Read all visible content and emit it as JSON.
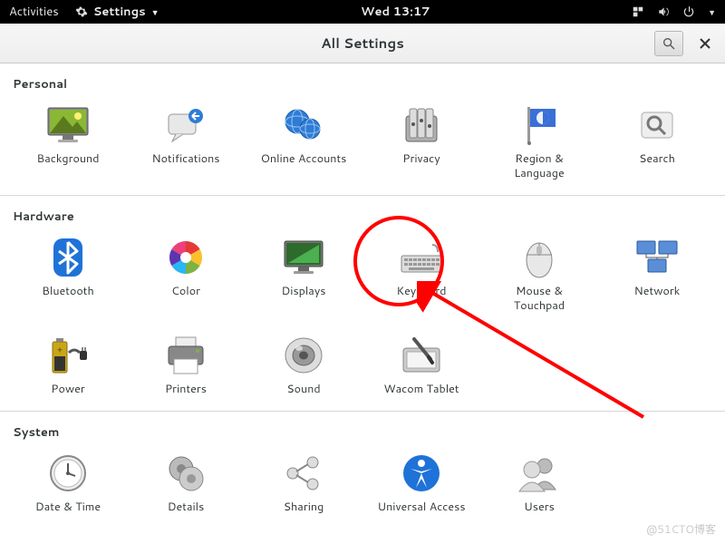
{
  "top_panel": {
    "activities": "Activities",
    "app_name": "Settings",
    "clock": "Wed 13:17"
  },
  "header": {
    "title": "All Settings"
  },
  "sections": {
    "personal": {
      "label": "Personal",
      "items": [
        {
          "name": "background",
          "label": "Background"
        },
        {
          "name": "notifications",
          "label": "Notifications"
        },
        {
          "name": "online-accounts",
          "label": "Online Accounts"
        },
        {
          "name": "privacy",
          "label": "Privacy"
        },
        {
          "name": "region-language",
          "label": "Region & Language"
        },
        {
          "name": "search",
          "label": "Search"
        }
      ]
    },
    "hardware": {
      "label": "Hardware",
      "items": [
        {
          "name": "bluetooth",
          "label": "Bluetooth"
        },
        {
          "name": "color",
          "label": "Color"
        },
        {
          "name": "displays",
          "label": "Displays"
        },
        {
          "name": "keyboard",
          "label": "Keyboard"
        },
        {
          "name": "mouse-touchpad",
          "label": "Mouse & Touchpad"
        },
        {
          "name": "network",
          "label": "Network"
        },
        {
          "name": "power",
          "label": "Power"
        },
        {
          "name": "printers",
          "label": "Printers"
        },
        {
          "name": "sound",
          "label": "Sound"
        },
        {
          "name": "wacom-tablet",
          "label": "Wacom Tablet"
        }
      ]
    },
    "system": {
      "label": "System",
      "items": [
        {
          "name": "date-time",
          "label": "Date & Time"
        },
        {
          "name": "details",
          "label": "Details"
        },
        {
          "name": "sharing",
          "label": "Sharing"
        },
        {
          "name": "universal-access",
          "label": "Universal Access"
        },
        {
          "name": "users",
          "label": "Users"
        }
      ]
    }
  },
  "annotation": {
    "highlighted_item": "keyboard"
  },
  "watermark": "@51CTO博客"
}
